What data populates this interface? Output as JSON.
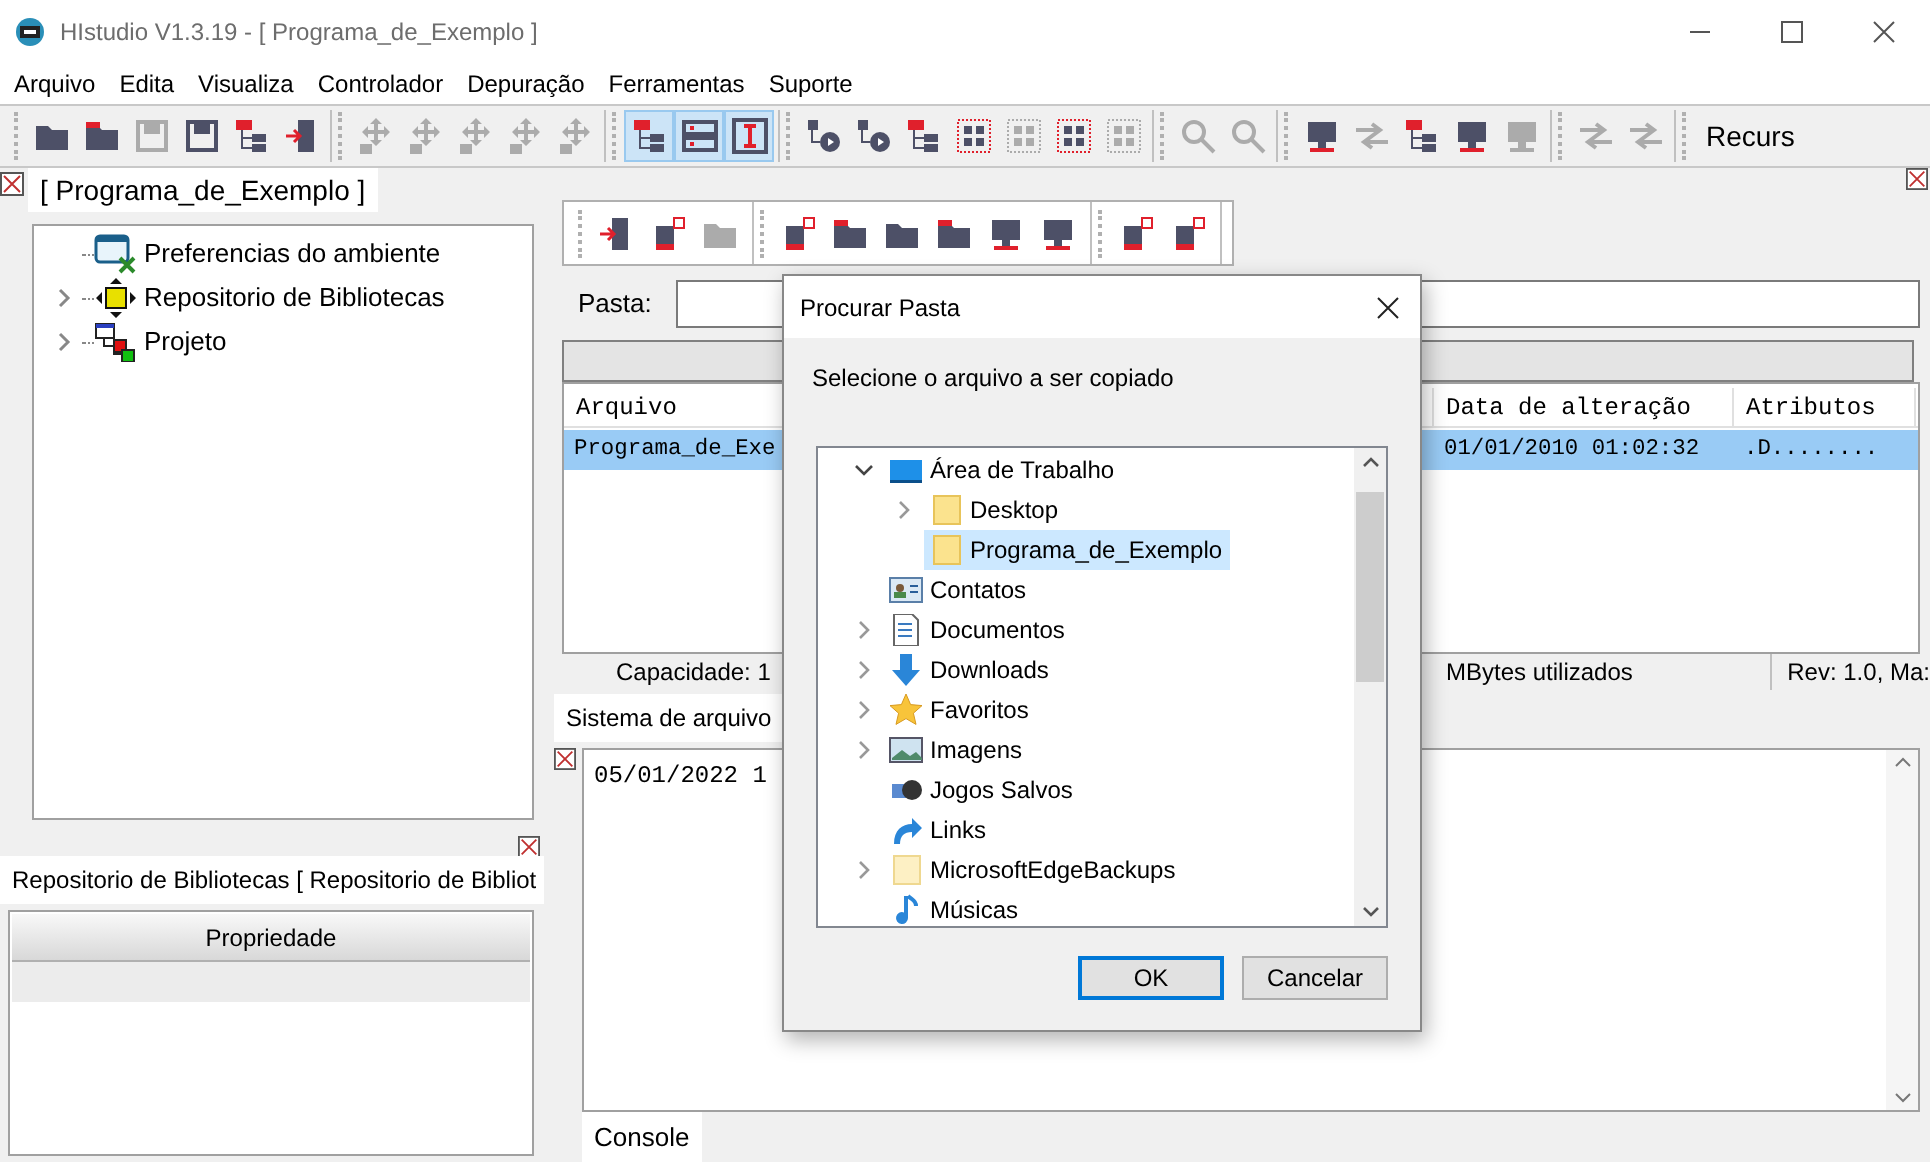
{
  "window": {
    "title": "HIstudio V1.3.19 - [ Programa_de_Exemplo ]"
  },
  "menu": [
    "Arquivo",
    "Edita",
    "Visualiza",
    "Controlador",
    "Depuração",
    "Ferramentas",
    "Suporte"
  ],
  "toolbar": {
    "groups": [
      [
        {
          "disabled": false,
          "selected": false
        },
        {
          "disabled": false,
          "selected": false
        },
        {
          "disabled": true,
          "selected": false
        },
        {
          "disabled": false,
          "selected": false
        },
        {
          "disabled": false,
          "selected": false
        },
        {
          "disabled": false,
          "selected": false
        }
      ],
      [
        {
          "disabled": true,
          "selected": false
        },
        {
          "disabled": true,
          "selected": false
        },
        {
          "disabled": true,
          "selected": false
        },
        {
          "disabled": true,
          "selected": false
        },
        {
          "disabled": true,
          "selected": false
        }
      ],
      [
        {
          "disabled": false,
          "selected": true
        },
        {
          "disabled": false,
          "selected": true
        },
        {
          "disabled": false,
          "selected": true
        }
      ],
      [
        {
          "disabled": false,
          "selected": false
        },
        {
          "disabled": false,
          "selected": false
        },
        {
          "disabled": false,
          "selected": false
        },
        {
          "disabled": false,
          "selected": false
        },
        {
          "disabled": true,
          "selected": false
        },
        {
          "disabled": false,
          "selected": false
        },
        {
          "disabled": true,
          "selected": false
        }
      ],
      [
        {
          "disabled": true,
          "selected": false
        },
        {
          "disabled": true,
          "selected": false
        }
      ],
      [
        {
          "disabled": false,
          "selected": false
        },
        {
          "disabled": true,
          "selected": false
        },
        {
          "disabled": false,
          "selected": false
        },
        {
          "disabled": false,
          "selected": false
        },
        {
          "disabled": true,
          "selected": false
        }
      ],
      [
        {
          "disabled": true,
          "selected": false
        },
        {
          "disabled": true,
          "selected": false
        }
      ]
    ],
    "overflow_label": "Recurs"
  },
  "project_panel": {
    "tab": "[ Programa_de_Exemplo ]",
    "tree": [
      {
        "label": "Preferencias do ambiente"
      },
      {
        "label": "Repositorio de Bibliotecas",
        "expanded": false
      },
      {
        "label": "Projeto",
        "expanded": false
      }
    ]
  },
  "properties_panel": {
    "tab": "Repositorio de Bibliotecas [ Repositorio de Bibliot",
    "columns": [
      "Propriedade"
    ]
  },
  "file_panel": {
    "toolbar": {
      "groups": [
        [
          {
            "disabled": false
          },
          {
            "disabled": false
          },
          {
            "disabled": true
          }
        ],
        [
          {
            "disabled": false
          },
          {
            "disabled": false
          },
          {
            "disabled": false
          },
          {
            "disabled": false
          },
          {
            "disabled": false
          },
          {
            "disabled": false
          }
        ],
        [
          {
            "disabled": false
          },
          {
            "disabled": false
          }
        ]
      ]
    },
    "path_label": "Pasta:",
    "table": {
      "columns": [
        "Arquivo",
        "Data de alteração",
        "Atributos"
      ],
      "rows": [
        {
          "cells": [
            "Programa_de_Exe",
            "01/01/2010 01:02:32",
            ".D........"
          ],
          "selected": true
        }
      ]
    },
    "status": [
      "Capacidade: 1",
      "MBytes utilizados",
      "Rev: 1.0, Ma:"
    ],
    "tab": "Sistema de arquivo"
  },
  "console": {
    "lines": [
      "05/01/2022 1"
    ],
    "tab": "Console"
  },
  "dialog": {
    "title": "Procurar Pasta",
    "prompt": "Selecione o arquivo a ser copiado",
    "tree": [
      {
        "label": "Área de Trabalho",
        "expanded": true,
        "selected": false,
        "children": [
          {
            "label": "Desktop",
            "expanded": false,
            "selected": false
          },
          {
            "label": "Programa_de_Exemplo",
            "selected": true
          }
        ]
      },
      {
        "label": "Contatos",
        "selected": false
      },
      {
        "label": "Documentos",
        "expanded": false,
        "selected": false
      },
      {
        "label": "Downloads",
        "expanded": false,
        "selected": false
      },
      {
        "label": "Favoritos",
        "expanded": false,
        "selected": false
      },
      {
        "label": "Imagens",
        "expanded": false,
        "selected": false
      },
      {
        "label": "Jogos Salvos",
        "selected": false
      },
      {
        "label": "Links",
        "selected": false
      },
      {
        "label": "MicrosoftEdgeBackups",
        "expanded": false,
        "selected": false
      },
      {
        "label": "Músicas",
        "selected": false
      }
    ],
    "buttons": [
      {
        "label": "OK",
        "default": true
      },
      {
        "label": "Cancelar",
        "default": false
      }
    ]
  }
}
